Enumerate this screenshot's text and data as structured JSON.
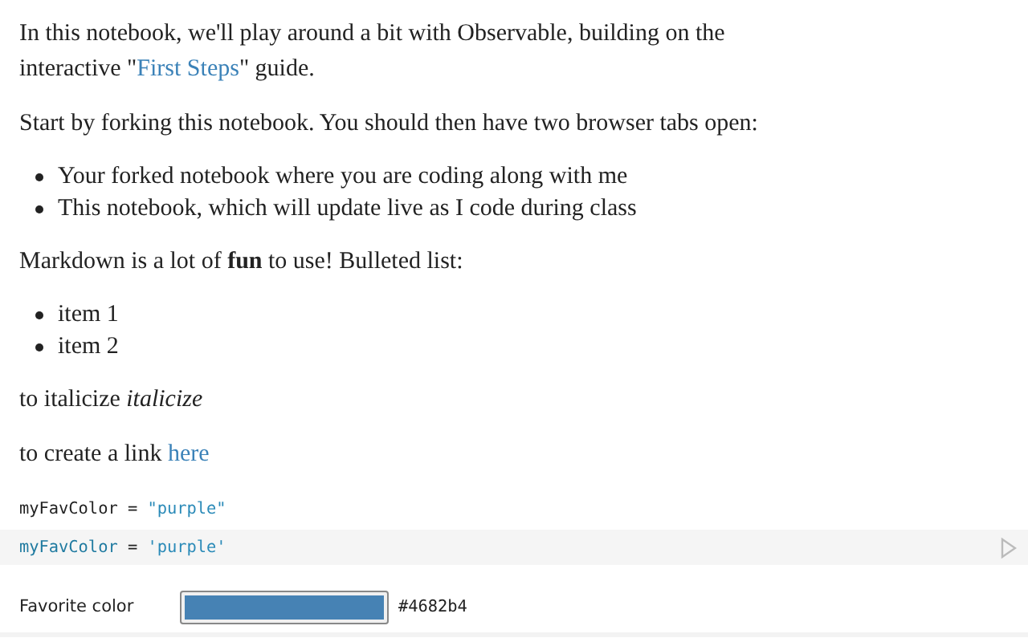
{
  "cells": [
    {
      "kind": "paragraph",
      "parts": [
        {
          "text": "In this notebook, we'll play around a bit with Observable, building on the interactive \""
        },
        {
          "link": "First Steps"
        },
        {
          "text": "\" guide."
        }
      ]
    },
    {
      "kind": "paragraph",
      "parts": [
        {
          "text": "Start by forking this notebook. You should then have two browser tabs open:"
        }
      ]
    },
    {
      "kind": "list",
      "items": [
        "Your forked notebook where you are coding along with me",
        "This notebook, which will update live as I code during class"
      ]
    },
    {
      "kind": "paragraph",
      "parts": [
        {
          "text": "Markdown is a lot of **fun** to use! Bulleted list:"
        }
      ]
    },
    {
      "kind": "list",
      "items": [
        "item 1",
        "item 2"
      ]
    },
    {
      "kind": "paragraph",
      "parts": [
        {
          "text": "to italicize *italicize*"
        }
      ]
    },
    {
      "kind": "paragraph",
      "parts": [
        {
          "text": "to create a link "
        },
        {
          "link": "here"
        }
      ]
    },
    {
      "kind": "output",
      "name": "myFavColor",
      "operator": "=",
      "value": "\"purple\""
    },
    {
      "kind": "source",
      "name": "myFavColor",
      "operator": "=",
      "value": "'purple'"
    },
    {
      "kind": "color_input",
      "label": "Favorite color",
      "value": "#4682b4"
    }
  ]
}
